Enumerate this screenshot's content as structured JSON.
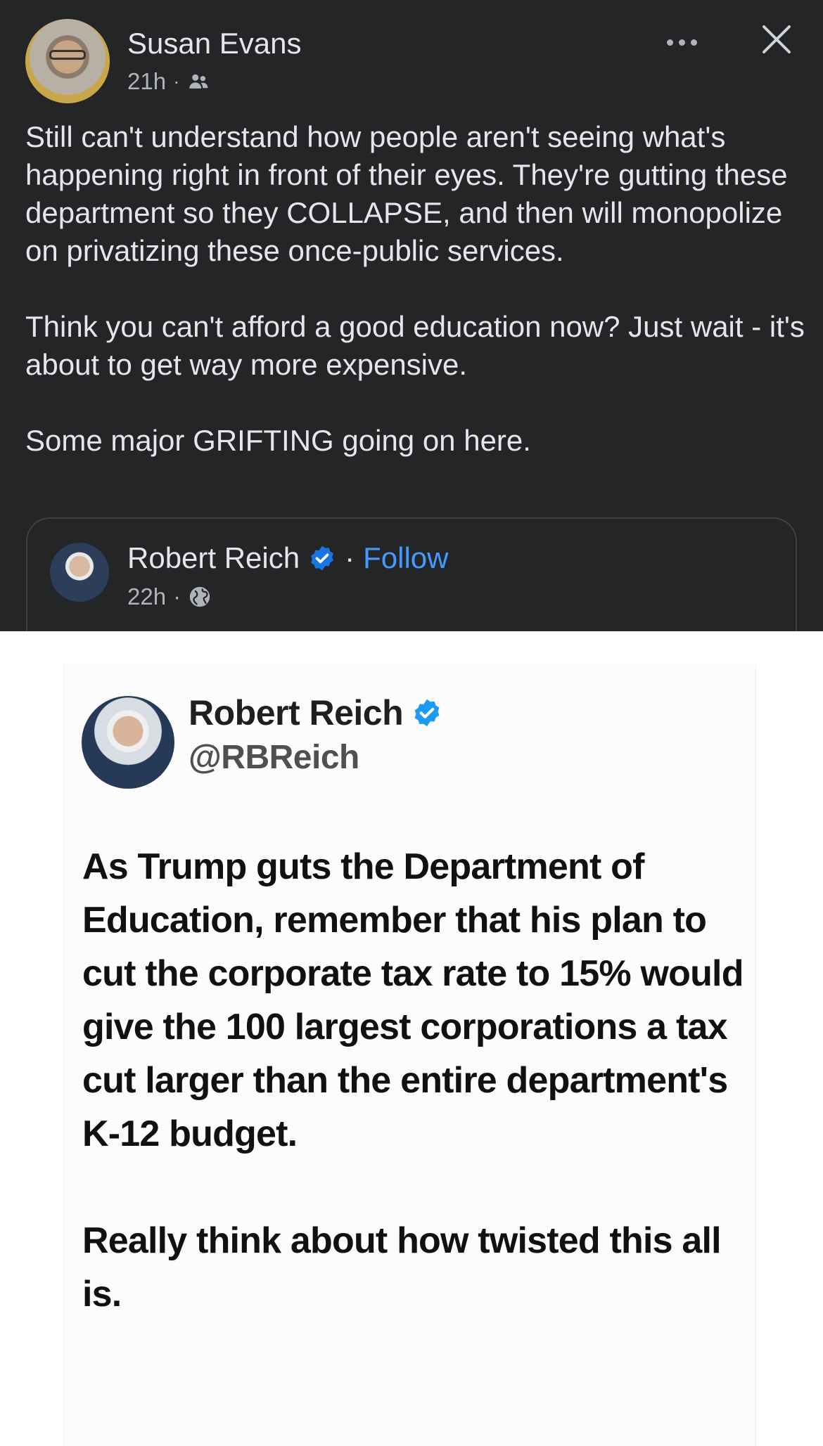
{
  "post": {
    "author": "Susan Evans",
    "time": "21h",
    "separator": "·",
    "audience_icon": "friends-icon",
    "paragraphs": [
      "Still can't understand how people aren't seeing what's happening right in front of their eyes. They're gutting these department so they COLLAPSE, and then will monopolize on privatizing these once-public services.",
      "Think you can't afford a good education now? Just wait - it's about to get way more expensive.",
      "Some major GRIFTING going on here."
    ]
  },
  "shared": {
    "author": "Robert Reich",
    "separator": "·",
    "follow_label": "Follow",
    "time": "22h",
    "audience_icon": "globe-icon"
  },
  "tweet": {
    "name": "Robert Reich",
    "handle": "@RBReich",
    "paragraphs": [
      "As Trump guts the Department of Education, remember that his plan to cut the corporate tax rate to 15% would give the 100 largest corporations a tax cut larger than the entire department's K-12 budget.",
      "Really think about how twisted this all is."
    ]
  },
  "colors": {
    "dark_bg": "#242526",
    "text_primary": "#e4e6eb",
    "text_secondary": "#b0b3b8",
    "link_blue": "#4599ff",
    "verified_blue": "#1d9bf0"
  }
}
